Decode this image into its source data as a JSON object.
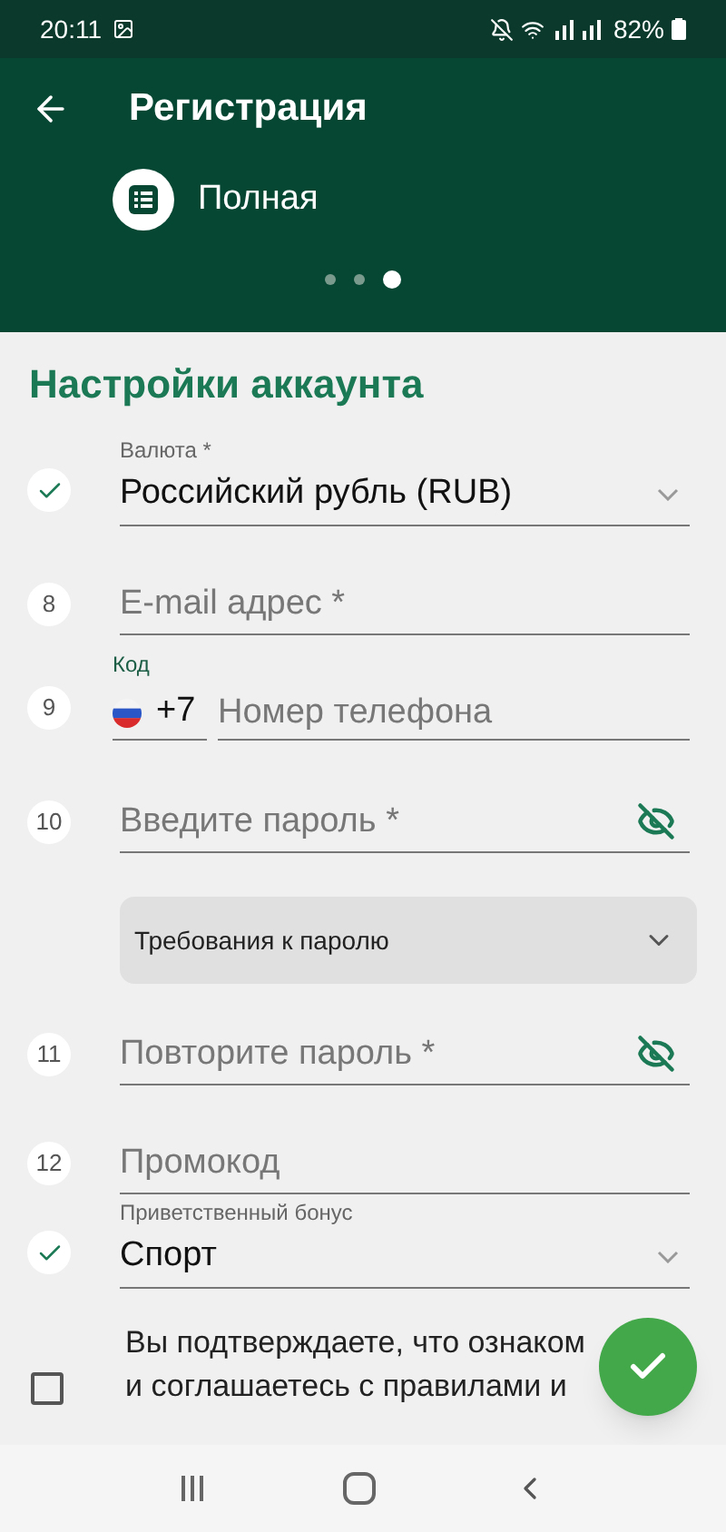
{
  "status_bar": {
    "time": "20:11",
    "battery": "82%"
  },
  "header": {
    "title": "Регистрация",
    "step_label": "Полная",
    "dots": [
      {
        "selected": false
      },
      {
        "selected": false
      },
      {
        "selected": true
      }
    ]
  },
  "section_title": "Настройки аккаунта",
  "fields": [
    {
      "kind": "select",
      "done": true,
      "label": "Валюта *",
      "value": "Российский рубль (RUB)"
    },
    {
      "kind": "text",
      "done": false,
      "number": "8",
      "placeholder": "E-mail адрес *"
    },
    {
      "kind": "phone",
      "done": false,
      "number": "9",
      "code_label": "Код",
      "code": "+7",
      "placeholder": "Номер телефона"
    },
    {
      "kind": "password",
      "done": false,
      "number": "10",
      "placeholder": "Введите пароль *"
    },
    {
      "kind": "accordion",
      "label": "Требования к паролю",
      "expanded": false
    },
    {
      "kind": "password",
      "done": false,
      "number": "11",
      "placeholder": "Повторите пароль *"
    },
    {
      "kind": "text",
      "done": false,
      "number": "12",
      "placeholder": "Промокод"
    },
    {
      "kind": "select",
      "done": true,
      "label": "Приветственный бонус",
      "value": "Спорт"
    }
  ],
  "consent": {
    "lines": [
      "Вы подтверждаете, что ознаком",
      "и соглашаетесь с правилами и"
    ],
    "checked": false
  }
}
